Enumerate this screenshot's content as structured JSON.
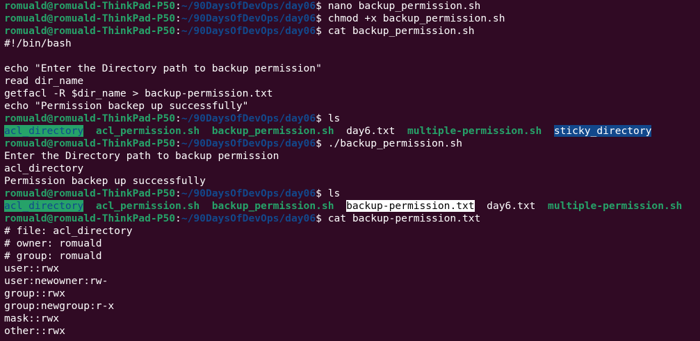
{
  "prompt": {
    "user_host": "romuald@romuald-ThinkPad-P50",
    "colon": ":",
    "path": "~/90DaysOfDevOps/day06",
    "symbol": "$ "
  },
  "lines": [
    {
      "type": "prompt",
      "command": "nano backup_permission.sh"
    },
    {
      "type": "prompt",
      "command": "chmod +x backup_permission.sh"
    },
    {
      "type": "prompt",
      "command": "cat backup_permission.sh"
    },
    {
      "type": "text",
      "text": "#!/bin/bash"
    },
    {
      "type": "text",
      "text": ""
    },
    {
      "type": "text",
      "text": "echo \"Enter the Directory path to backup permission\""
    },
    {
      "type": "text",
      "text": "read dir_name"
    },
    {
      "type": "text",
      "text": "getfacl -R $dir_name > backup-permission.txt"
    },
    {
      "type": "text",
      "text": "echo \"Permission backep up successfully\""
    },
    {
      "type": "prompt",
      "command": "ls"
    },
    {
      "type": "ls",
      "items": [
        {
          "name": "acl_directory",
          "style": "dir-acl"
        },
        {
          "name": "acl_permission.sh",
          "style": "exe"
        },
        {
          "name": "backup_permission.sh",
          "style": "exe"
        },
        {
          "name": "day6.txt",
          "style": "plain"
        },
        {
          "name": "multiple-permission.sh",
          "style": "exe"
        },
        {
          "name": "sticky_directory",
          "style": "dir-sticky"
        }
      ]
    },
    {
      "type": "prompt",
      "command": "./backup_permission.sh"
    },
    {
      "type": "text",
      "text": "Enter the Directory path to backup permission"
    },
    {
      "type": "text",
      "text": "acl_directory"
    },
    {
      "type": "text",
      "text": "Permission backep up successfully"
    },
    {
      "type": "prompt",
      "command": "ls"
    },
    {
      "type": "ls",
      "items": [
        {
          "name": "acl_directory",
          "style": "dir-acl"
        },
        {
          "name": "acl_permission.sh",
          "style": "exe"
        },
        {
          "name": "backup_permission.sh",
          "style": "exe"
        },
        {
          "name": "backup-permission.txt",
          "style": "hl-file"
        },
        {
          "name": "day6.txt",
          "style": "plain"
        },
        {
          "name": "multiple-permission.sh",
          "style": "exe"
        }
      ]
    },
    {
      "type": "prompt",
      "command": "cat backup-permission.txt"
    },
    {
      "type": "text",
      "text": "# file: acl_directory"
    },
    {
      "type": "text",
      "text": "# owner: romuald"
    },
    {
      "type": "text",
      "text": "# group: romuald"
    },
    {
      "type": "text",
      "text": "user::rwx"
    },
    {
      "type": "text",
      "text": "user:newowner:rw-"
    },
    {
      "type": "text",
      "text": "group::rwx"
    },
    {
      "type": "text",
      "text": "group:newgroup:r-x"
    },
    {
      "type": "text",
      "text": "mask::rwx"
    },
    {
      "type": "text",
      "text": "other::rwx"
    }
  ],
  "colors": {
    "background": "#300a24",
    "user_host": "#26a269",
    "path": "#12488b",
    "text": "#ffffff"
  }
}
